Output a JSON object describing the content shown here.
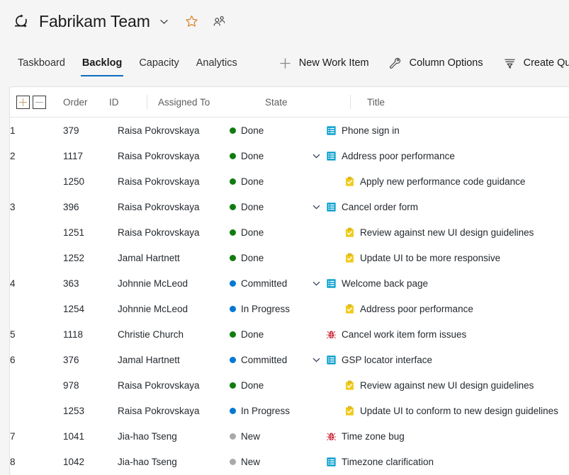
{
  "header": {
    "sprint_icon": "sprint-refresh-icon",
    "team_name": "Fabrikam Team",
    "team_chevron_icon": "chevron-down-icon",
    "favorite_icon": "star-outline-icon",
    "team_members_icon": "people-icon"
  },
  "nav": {
    "tabs": [
      {
        "label": "Taskboard",
        "active": false
      },
      {
        "label": "Backlog",
        "active": true
      },
      {
        "label": "Capacity",
        "active": false
      },
      {
        "label": "Analytics",
        "active": false
      }
    ],
    "commands": [
      {
        "label": "New Work Item",
        "icon": "plus-icon"
      },
      {
        "label": "Column Options",
        "icon": "wrench-icon"
      },
      {
        "label": "Create Query",
        "icon": "filter-lines-icon"
      }
    ]
  },
  "grid": {
    "expand_all_label": "+",
    "collapse_all_label": "−",
    "columns": [
      {
        "key": "order",
        "label": "Order"
      },
      {
        "key": "id",
        "label": "ID"
      },
      {
        "key": "assigned_to",
        "label": "Assigned To"
      },
      {
        "key": "state",
        "label": "State"
      },
      {
        "key": "title",
        "label": "Title"
      }
    ],
    "state_colors": {
      "Done": "#107c10",
      "Committed": "#0078d4",
      "In Progress": "#0078d4",
      "New": "#a9a9a9"
    },
    "type_colors": {
      "user-story": "#009ccc",
      "task": "#f2cb1d",
      "bug": "#cc293d"
    },
    "rows": [
      {
        "order": "1",
        "id": "379",
        "assigned_to": "Raisa Pokrovskaya",
        "state": "Done",
        "title": "Phone sign in",
        "type": "user-story",
        "level": 0,
        "expandable": false
      },
      {
        "order": "2",
        "id": "1117",
        "assigned_to": "Raisa Pokrovskaya",
        "state": "Done",
        "title": "Address poor performance",
        "type": "user-story",
        "level": 0,
        "expandable": true
      },
      {
        "order": "",
        "id": "1250",
        "assigned_to": "Raisa Pokrovskaya",
        "state": "Done",
        "title": "Apply new performance code guidance",
        "type": "task",
        "level": 1,
        "expandable": false
      },
      {
        "order": "3",
        "id": "396",
        "assigned_to": "Raisa Pokrovskaya",
        "state": "Done",
        "title": "Cancel order form",
        "type": "user-story",
        "level": 0,
        "expandable": true
      },
      {
        "order": "",
        "id": "1251",
        "assigned_to": "Raisa Pokrovskaya",
        "state": "Done",
        "title": "Review against new UI design guidelines",
        "type": "task",
        "level": 1,
        "expandable": false
      },
      {
        "order": "",
        "id": "1252",
        "assigned_to": "Jamal Hartnett",
        "state": "Done",
        "title": "Update UI to be more responsive",
        "type": "task",
        "level": 1,
        "expandable": false
      },
      {
        "order": "4",
        "id": "363",
        "assigned_to": "Johnnie McLeod",
        "state": "Committed",
        "title": "Welcome back page",
        "type": "user-story",
        "level": 0,
        "expandable": true
      },
      {
        "order": "",
        "id": "1254",
        "assigned_to": "Johnnie McLeod",
        "state": "In Progress",
        "title": "Address poor performance",
        "type": "task",
        "level": 1,
        "expandable": false
      },
      {
        "order": "5",
        "id": "1118",
        "assigned_to": "Christie Church",
        "state": "Done",
        "title": "Cancel work item form issues",
        "type": "bug",
        "level": 0,
        "expandable": false
      },
      {
        "order": "6",
        "id": "376",
        "assigned_to": "Jamal Hartnett",
        "state": "Committed",
        "title": "GSP locator interface",
        "type": "user-story",
        "level": 0,
        "expandable": true
      },
      {
        "order": "",
        "id": "978",
        "assigned_to": "Raisa Pokrovskaya",
        "state": "Done",
        "title": "Review against new UI design guidelines",
        "type": "task",
        "level": 1,
        "expandable": false
      },
      {
        "order": "",
        "id": "1253",
        "assigned_to": "Raisa Pokrovskaya",
        "state": "In Progress",
        "title": "Update UI to conform to new design guidelines",
        "type": "task",
        "level": 1,
        "expandable": false
      },
      {
        "order": "7",
        "id": "1041",
        "assigned_to": "Jia-hao Tseng",
        "state": "New",
        "title": "Time zone bug",
        "type": "bug",
        "level": 0,
        "expandable": false
      },
      {
        "order": "8",
        "id": "1042",
        "assigned_to": "Jia-hao Tseng",
        "state": "New",
        "title": "Timezone clarification",
        "type": "user-story",
        "level": 0,
        "expandable": false
      }
    ]
  }
}
